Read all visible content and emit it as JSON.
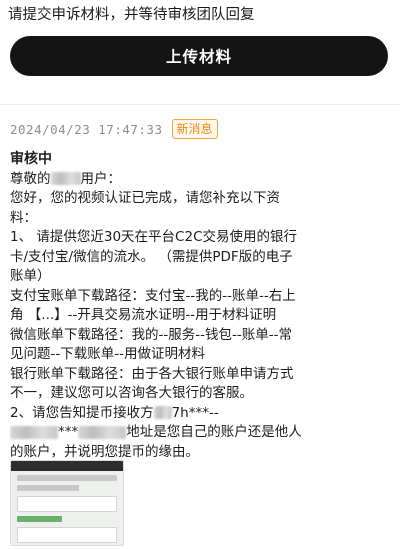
{
  "header": {
    "notice": "请提交申诉材料，并等待审核团队回复",
    "upload_button_label": "上传材料"
  },
  "message": {
    "timestamp": "2024/04/23 17:47:33",
    "badge": "新消息",
    "status_title": "审核中",
    "greeting_prefix": "尊敬的",
    "greeting_suffix": "用户：",
    "body_lines": [
      "您好，您的视频认证已完成，请您补充以下资",
      "料：",
      "1、 请提供您近30天在平台C2C交易使用的银行",
      "卡/支付宝/微信的流水。 （需提供PDF版的电子",
      "账单）",
      "支付宝账单下载路径：支付宝--我的--账单--右上",
      "角 【...】--开具交易流水证明--用于材料证明",
      "微信账单下载路径：我的--服务--钱包--账单--常",
      "见问题--下载账单--用做证明材料",
      "银行账单下载路径：由于各大银行账单申请方式",
      "不一，建议您可以咨询各大银行的客服。"
    ],
    "line12_prefix": "2、请您告知提币接收方",
    "line12_suffix": "7h***--",
    "line13_mid": "***",
    "line13_suffix": "地址是您自己的账户还是他人",
    "line14": "的账户，并说明您提币的缘由。"
  },
  "attachment": {
    "icon": "image-thumbnail-icon"
  }
}
